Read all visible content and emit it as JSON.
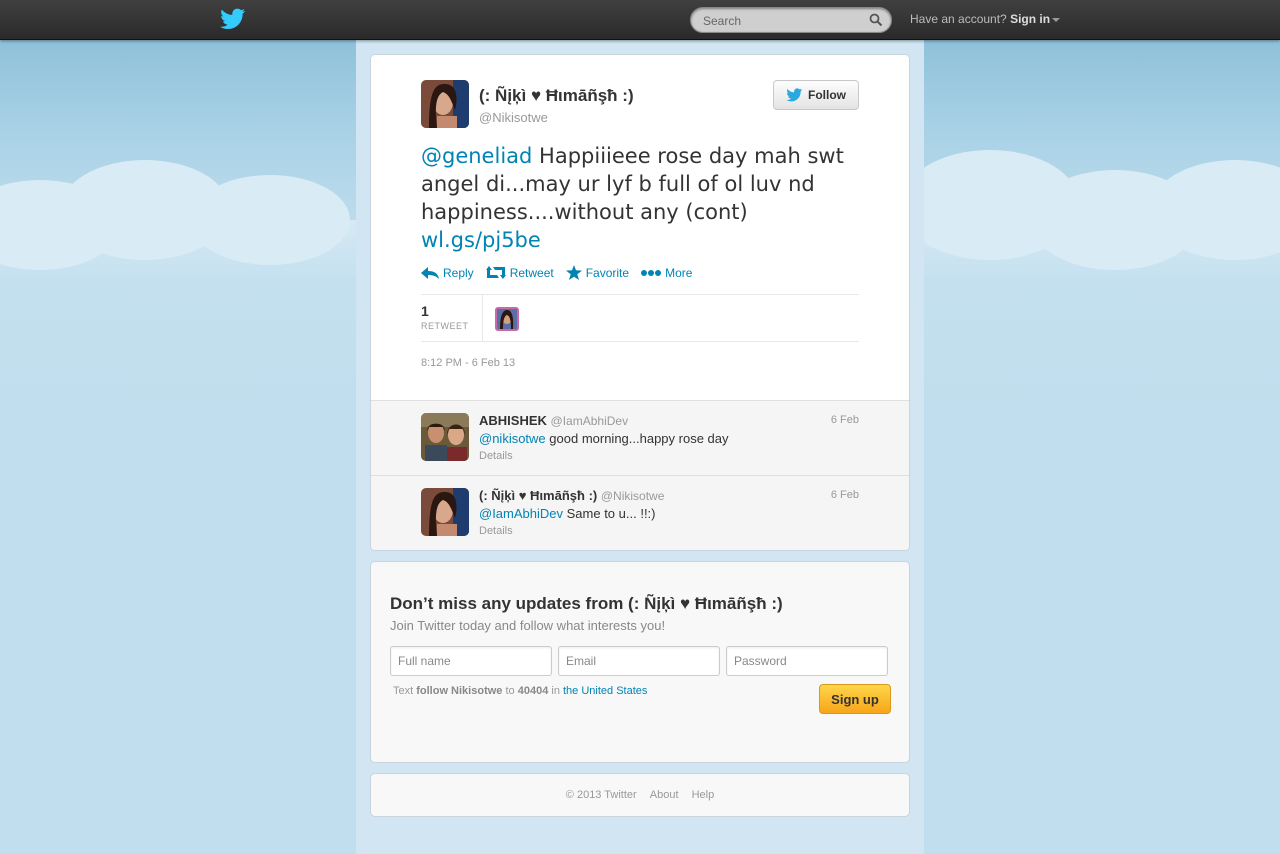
{
  "topbar": {
    "search_placeholder": "Search",
    "have_account": "Have an account?",
    "sign_in": "Sign in"
  },
  "tweet": {
    "fullname": "(: Ñįķì ♥ Ħιmāñşħ :)",
    "username": "@Nikisotwe",
    "follow_label": "Follow",
    "mention": "@geneliad",
    "body": " Happiiieee rose day mah swt angel di...may ur lyf b full of ol luv nd happiness....without any (cont) ",
    "link": "wl.gs/pj5be",
    "actions": {
      "reply": "Reply",
      "retweet": "Retweet",
      "favorite": "Favorite",
      "more": "More"
    },
    "retweet_count": "1",
    "retweet_label": "RETWEET",
    "timestamp": "8:12 PM - 6 Feb 13"
  },
  "replies": [
    {
      "fullname": "ABHISHEK",
      "username": "@IamAbhiDev",
      "time": "6 Feb",
      "mention": "@nikisotwe",
      "text": " good morning...happy rose day",
      "details": "Details"
    },
    {
      "fullname": "(: Ñįķì ♥ Ħιmāñşħ :)",
      "username": "@Nikisotwe",
      "time": "6 Feb",
      "mention": "@IamAbhiDev",
      "text": " Same to u... !!:)",
      "details": "Details"
    }
  ],
  "signup": {
    "title": "Don’t miss any updates from (: Ñįķì ♥ Ħιmāñşħ :)",
    "subtitle": "Join Twitter today and follow what interests you!",
    "fullname_placeholder": "Full name",
    "email_placeholder": "Email",
    "password_placeholder": "Password",
    "sms_prefix": "Text ",
    "sms_command": "follow Nikisotwe",
    "sms_to": " to ",
    "sms_number": "40404",
    "sms_in": " in ",
    "sms_country": "the United States",
    "button": "Sign up"
  },
  "footer": {
    "copyright": "© 2013 Twitter",
    "about": "About",
    "help": "Help"
  },
  "colors": {
    "link": "#0084b4",
    "background": "#c0deed",
    "signup_button": "#f7a51a"
  }
}
